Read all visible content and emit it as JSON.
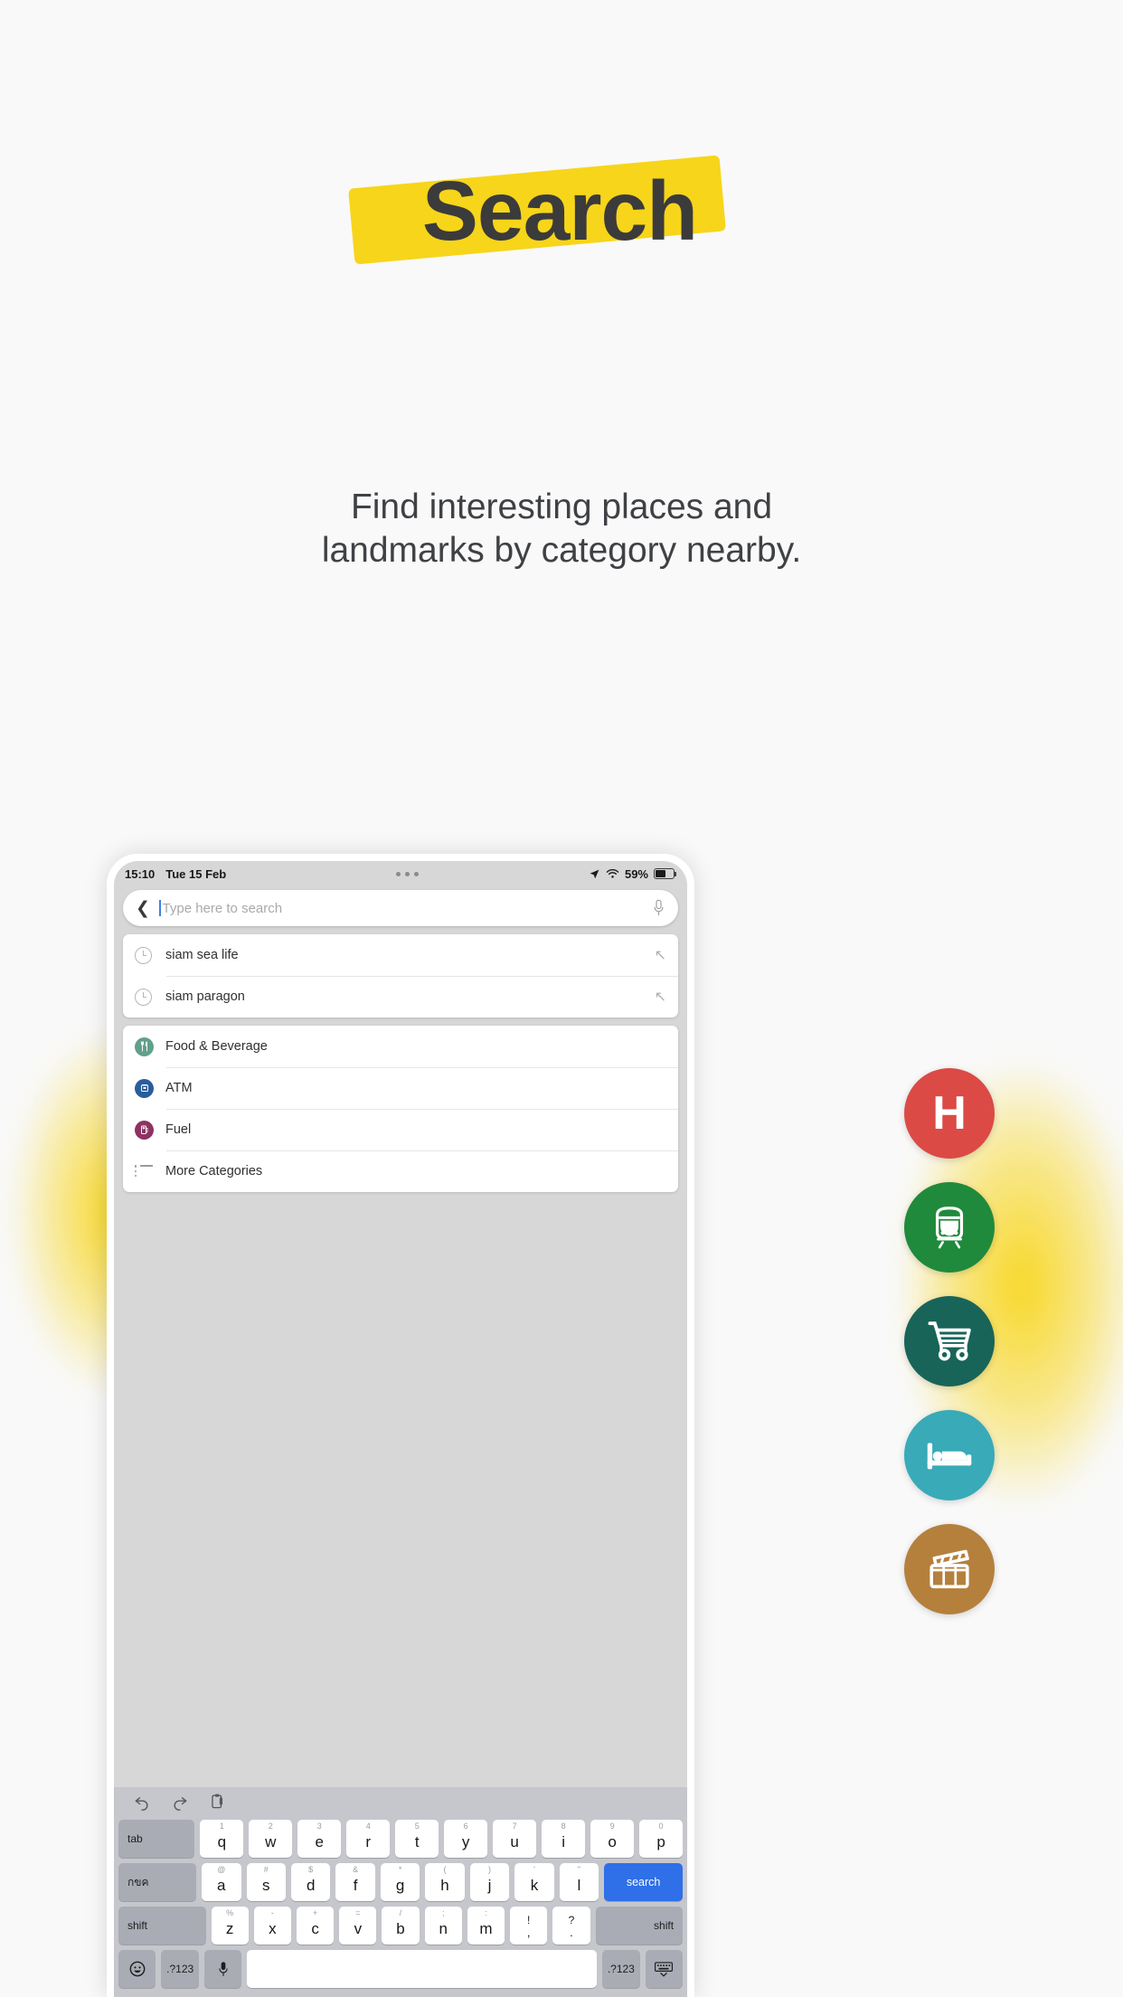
{
  "hero": {
    "title": "Search",
    "subtitle_line1": "Find interesting places and",
    "subtitle_line2": "landmarks by category nearby.",
    "highlight_color": "#F7D51A",
    "title_color": "#3b3b3b"
  },
  "status_bar": {
    "time": "15:10",
    "date": "Tue 15 Feb",
    "battery_percent": "59%"
  },
  "search": {
    "placeholder": "Type here to search",
    "value": "",
    "back_icon": "chevron-left-icon",
    "mic_icon": "microphone-icon"
  },
  "recent_searches": [
    {
      "label": "siam sea life",
      "icon": "history-clock-icon",
      "tail_icon": "arrow-up-left-icon"
    },
    {
      "label": "siam paragon",
      "icon": "history-clock-icon",
      "tail_icon": "arrow-up-left-icon"
    }
  ],
  "categories": [
    {
      "label": "Food & Beverage",
      "icon": "restaurant-icon",
      "color": "#62a08c"
    },
    {
      "label": "ATM",
      "icon": "atm-icon",
      "color": "#2b5d9b"
    },
    {
      "label": "Fuel",
      "icon": "fuel-pump-icon",
      "color": "#8d3361"
    },
    {
      "label": "More Categories",
      "icon": "list-icon",
      "color": "#9a9a9e"
    }
  ],
  "floating_buttons": [
    {
      "name": "hospital",
      "glyph": "H",
      "icon": "hospital-h-icon",
      "color": "#dc4a45"
    },
    {
      "name": "train",
      "glyph": "",
      "icon": "train-icon",
      "color": "#1f8a3b"
    },
    {
      "name": "shopping",
      "glyph": "",
      "icon": "shopping-cart-icon",
      "color": "#186459"
    },
    {
      "name": "hotel",
      "glyph": "",
      "icon": "bed-icon",
      "color": "#38aab8"
    },
    {
      "name": "cinema",
      "glyph": "",
      "icon": "clapperboard-icon",
      "color": "#b5803c"
    }
  ],
  "keyboard": {
    "toolbar": [
      "undo-icon",
      "redo-icon",
      "paste-icon"
    ],
    "row1": [
      {
        "main": "tab",
        "type": "mod",
        "wide": "wide-tab",
        "align": "left"
      },
      {
        "alt": "1",
        "main": "q"
      },
      {
        "alt": "2",
        "main": "w"
      },
      {
        "alt": "3",
        "main": "e"
      },
      {
        "alt": "4",
        "main": "r"
      },
      {
        "alt": "5",
        "main": "t"
      },
      {
        "alt": "6",
        "main": "y"
      },
      {
        "alt": "7",
        "main": "u"
      },
      {
        "alt": "8",
        "main": "i"
      },
      {
        "alt": "9",
        "main": "o"
      },
      {
        "alt": "0",
        "main": "p"
      }
    ],
    "row2": [
      {
        "main": "กขค",
        "type": "mod",
        "wide": "wide-caps",
        "align": "left"
      },
      {
        "alt": "@",
        "main": "a"
      },
      {
        "alt": "#",
        "main": "s"
      },
      {
        "alt": "$",
        "main": "d"
      },
      {
        "alt": "&",
        "main": "f"
      },
      {
        "alt": "*",
        "main": "g"
      },
      {
        "alt": "(",
        "main": "h"
      },
      {
        "alt": ")",
        "main": "j"
      },
      {
        "alt": "'",
        "main": "k"
      },
      {
        "alt": "\"",
        "main": "l"
      },
      {
        "main": "search",
        "type": "go",
        "wide": "wide-ret"
      }
    ],
    "row3": [
      {
        "main": "shift",
        "type": "mod",
        "wide": "wide-shift",
        "align": "left"
      },
      {
        "alt": "%",
        "main": "z"
      },
      {
        "alt": "-",
        "main": "x"
      },
      {
        "alt": "+",
        "main": "c"
      },
      {
        "alt": "=",
        "main": "v"
      },
      {
        "alt": "/",
        "main": "b"
      },
      {
        "alt": ";",
        "main": "n"
      },
      {
        "alt": ":",
        "main": "m"
      },
      {
        "dual_up": "!",
        "dual_down": ","
      },
      {
        "dual_up": "?",
        "dual_down": "."
      },
      {
        "main": "shift",
        "type": "mod",
        "wide": "wide-shift",
        "align": "right"
      }
    ],
    "row4": [
      {
        "main": "",
        "icon": "emoji-icon",
        "type": "mod",
        "wide": "small"
      },
      {
        "main": ".?123",
        "type": "mod",
        "wide": "small"
      },
      {
        "main": "",
        "icon": "microphone-icon",
        "type": "mod",
        "wide": "small"
      },
      {
        "main": "",
        "type": "space",
        "wide": "space"
      },
      {
        "main": ".?123",
        "type": "mod",
        "wide": "small"
      },
      {
        "main": "",
        "icon": "hide-keyboard-icon",
        "type": "mod",
        "wide": "small"
      }
    ]
  }
}
